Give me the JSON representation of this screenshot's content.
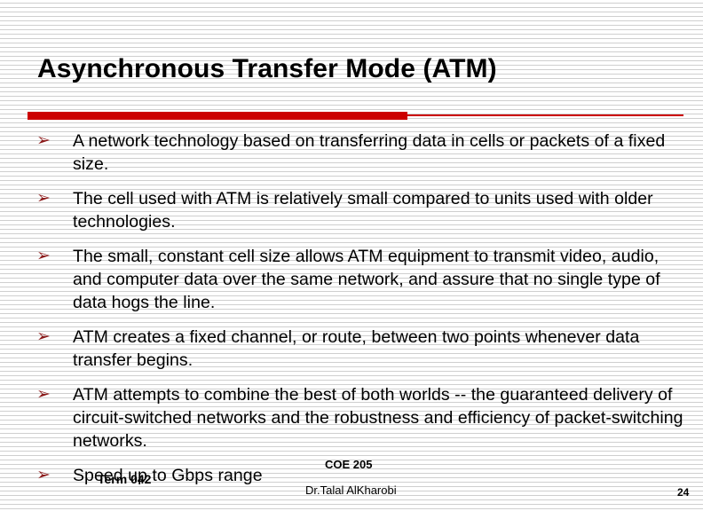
{
  "slide": {
    "title": "Asynchronous Transfer Mode (ATM)",
    "bullet_glyph": "➢",
    "accent_color": "#CC0000",
    "bullet_color": "#8B1A1A",
    "text_color": "#000000",
    "background_color": "#FFFFFF",
    "bullets": [
      {
        "text": "A network technology based on transferring data in cells or packets of a fixed size."
      },
      {
        "text": "The cell used with ATM is relatively small compared to units used with older technologies."
      },
      {
        "text": "The small, constant cell size allows ATM equipment to transmit video, audio, and computer data over the same network, and assure that no single type of data hogs the line."
      },
      {
        "text": "ATM creates a fixed channel, or route, between two points whenever data transfer begins."
      },
      {
        "text": "ATM attempts to combine the best of both worlds -- the guaranteed delivery of circuit-switched networks and the robustness and efficiency of packet-switching networks."
      },
      {
        "text": "Speed up to Gbps range"
      }
    ],
    "footer": {
      "course": "COE 205",
      "term": "Term 042",
      "author": "Dr.Talal AlKharobi",
      "page_number": "24"
    }
  }
}
